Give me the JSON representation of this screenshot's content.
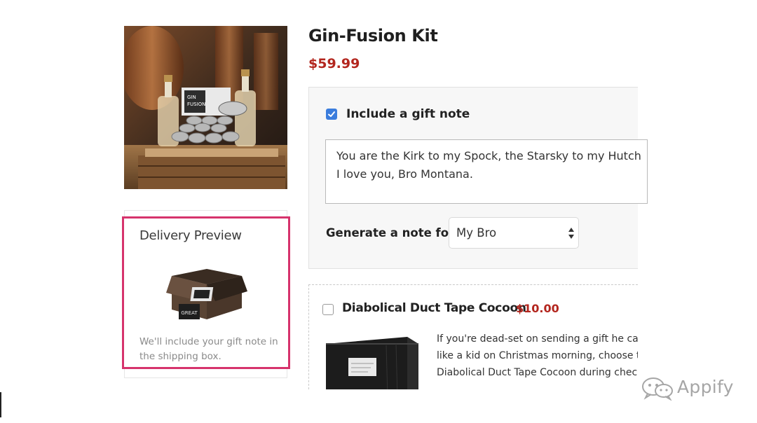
{
  "product": {
    "title": "Gin-Fusion Kit",
    "price": "$59.99",
    "image_alt": "gin-fusion-kit-photo"
  },
  "gift_note": {
    "checkbox_label": "Include a gift note",
    "checked": true,
    "note_text": "You are the Kirk to my Spock, the Starsky to my Hutch\nI love you, Bro Montana.",
    "generate_label": "Generate a note for:",
    "generate_selected": "My Bro"
  },
  "delivery_preview": {
    "title": "Delivery Preview",
    "caption": "We'll include your gift note in the shipping box.",
    "box_tag": "GREAT"
  },
  "addon": {
    "checked": false,
    "name": "Diabolical Duct Tape Cocoon",
    "price": "$10.00",
    "description": "If you're dead-set on sending a gift he can\nlike a kid on Christmas morning, choose the\nDiabolical Duct Tape Cocoon during checkout"
  },
  "watermark": {
    "text": "Appify",
    "icon": "wechat-icon"
  },
  "colors": {
    "price_red": "#b3261e",
    "highlight_pink": "#d6336c",
    "checkbox_blue": "#3b7ddd"
  }
}
